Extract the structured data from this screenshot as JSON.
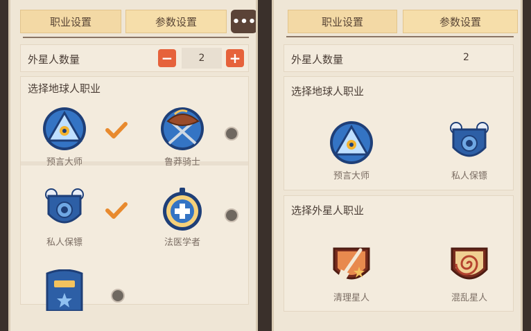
{
  "colors": {
    "panel_bg": "#efe6d6",
    "tab_bg": "#f3d9a5",
    "stepper_accent": "#e6623b",
    "check_orange": "#e88a2e",
    "badge_blue": "#2f67b3",
    "badge_red": "#b5432f"
  },
  "left": {
    "tabs": [
      {
        "label": "职业设置"
      },
      {
        "label": "参数设置"
      }
    ],
    "more_icon": "ellipsis-icon",
    "alien_count_label": "外星人数量",
    "alien_count_value": "2",
    "minus_label": "−",
    "plus_label": "+",
    "earth_section_title": "选择地球人职业",
    "roles": [
      {
        "name": "预言大师",
        "icon": "eye-triangle-icon",
        "selected": true
      },
      {
        "name": "鲁莽骑士",
        "icon": "knight-helmet-icon",
        "selected": false
      },
      {
        "name": "私人保镖",
        "icon": "shield-bodyguard-icon",
        "selected": true
      },
      {
        "name": "法医学者",
        "icon": "medical-stopwatch-icon",
        "selected": false
      },
      {
        "name": "",
        "icon": "police-badge-icon",
        "selected": false
      }
    ]
  },
  "right": {
    "tabs": [
      {
        "label": "职业设置"
      },
      {
        "label": "参数设置"
      }
    ],
    "alien_count_label": "外星人数量",
    "alien_count_value": "2",
    "earth_section_title": "选择地球人职业",
    "earth_roles": [
      {
        "name": "预言大师",
        "icon": "eye-triangle-icon"
      },
      {
        "name": "私人保镖",
        "icon": "shield-bodyguard-icon"
      }
    ],
    "alien_section_title": "选择外星人职业",
    "alien_roles": [
      {
        "name": "清理星人",
        "icon": "broom-cleaner-icon"
      },
      {
        "name": "混乱星人",
        "icon": "spiral-chaos-icon"
      }
    ]
  }
}
